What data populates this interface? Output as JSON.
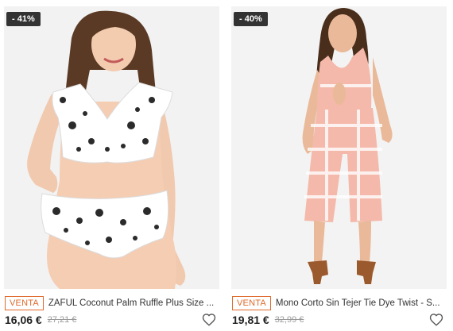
{
  "products": [
    {
      "discount_badge": "- 41%",
      "sale_tag": "VENTA",
      "title": "ZAFUL Coconut Palm Ruffle Plus Size ...",
      "price": "16,06 €",
      "old_price": "27,21 €",
      "image_icon": "swimsuit-photo",
      "favorite_icon": "heart-icon"
    },
    {
      "discount_badge": "- 40%",
      "sale_tag": "VENTA",
      "title": "Mono Corto Sin Tejer Tie Dye Twist - S...",
      "price": "19,81 €",
      "old_price": "32,99 €",
      "image_icon": "jumpsuit-photo",
      "favorite_icon": "heart-icon"
    }
  ],
  "colors": {
    "sale_accent": "#e06a2c",
    "badge_bg": "#333333",
    "image_bg": "#f1f1f1"
  }
}
